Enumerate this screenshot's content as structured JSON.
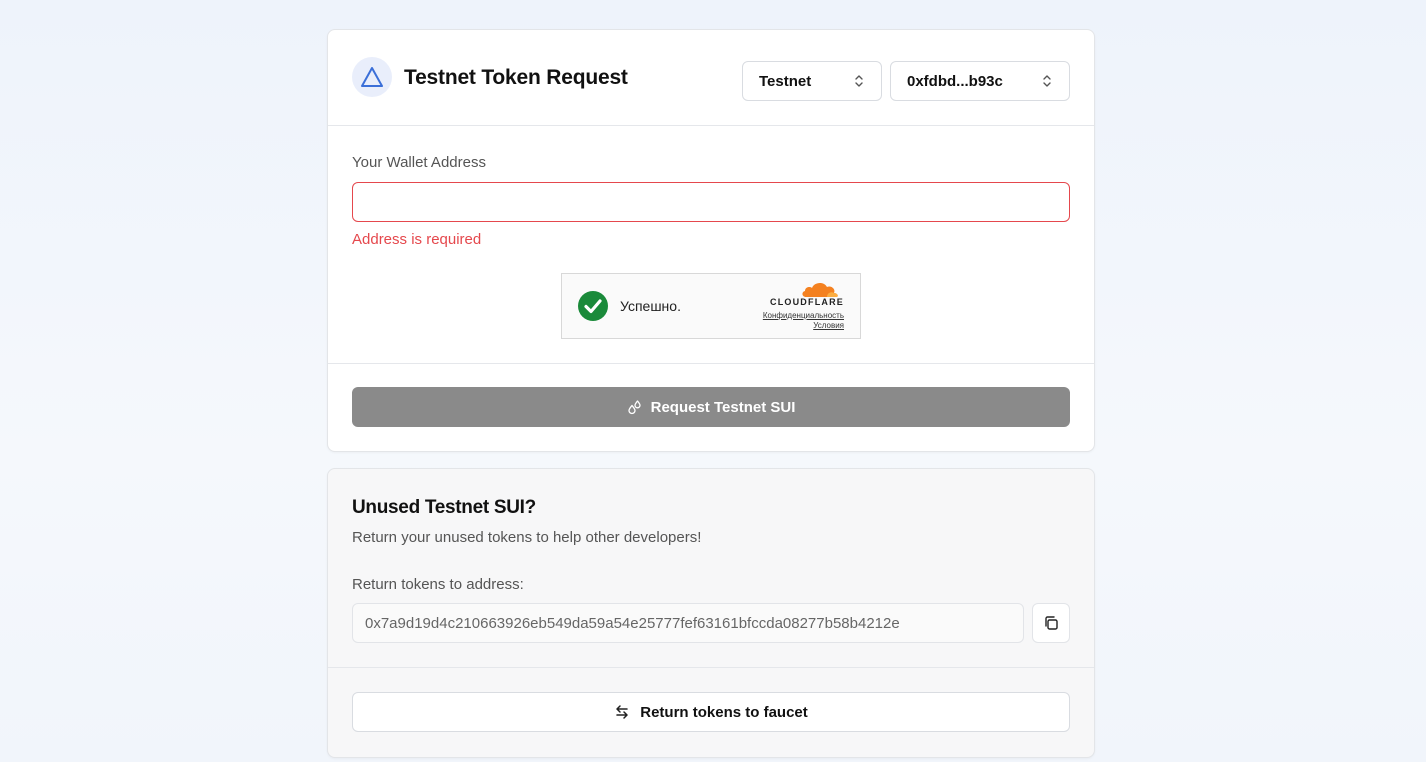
{
  "header": {
    "title": "Testnet Token Request",
    "network_select": {
      "value": "Testnet"
    },
    "address_select": {
      "value": "0xfdbd...b93c"
    },
    "logo_icon": "sui-triangle-icon"
  },
  "form": {
    "wallet_label": "Your Wallet Address",
    "wallet_value": "",
    "error": "Address is required",
    "captcha": {
      "status": "Успешно.",
      "provider": "CLOUDFLARE",
      "privacy": "Конфиденциальность",
      "terms": "Условия"
    },
    "request_button": "Request Testnet SUI"
  },
  "return_section": {
    "title": "Unused Testnet SUI?",
    "description": "Return your unused tokens to help other developers!",
    "address_label": "Return tokens to address:",
    "address": "0x7a9d19d4c210663926eb549da59a54e25777fef63161bfccda08277b58b4212e",
    "return_button": "Return tokens to faucet"
  },
  "colors": {
    "error": "#e5484d",
    "accent": "#3b6fd8",
    "captcha_success": "#1a8a3a",
    "cloudflare_orange": "#f48120",
    "disabled_button": "#8a8a8a"
  }
}
